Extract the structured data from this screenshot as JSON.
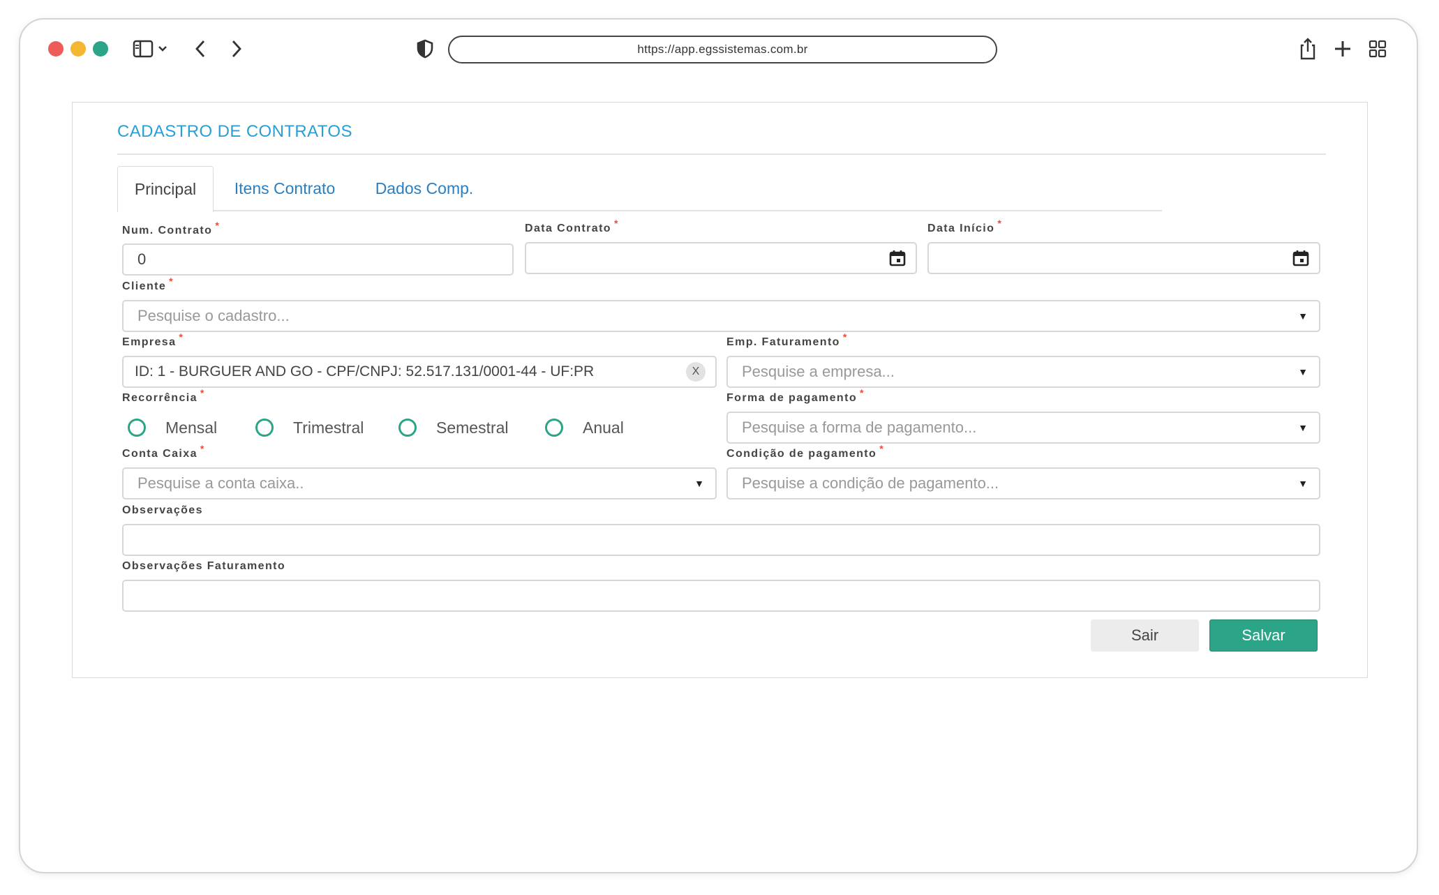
{
  "browser": {
    "url": "https://app.egssistemas.com.br",
    "colors": {
      "close": "#ed5c57",
      "minimize": "#f4b731",
      "zoom": "#2ca488"
    }
  },
  "page": {
    "title": "CADASTRO DE CONTRATOS",
    "tabs": [
      {
        "label": "Principal",
        "active": true
      },
      {
        "label": "Itens Contrato",
        "active": false
      },
      {
        "label": "Dados Comp.",
        "active": false
      }
    ]
  },
  "form": {
    "num_contrato": {
      "label": "Num. Contrato",
      "value": "0"
    },
    "data_contrato": {
      "label": "Data Contrato",
      "value": ""
    },
    "data_inicio": {
      "label": "Data Início",
      "value": ""
    },
    "cliente": {
      "label": "Cliente",
      "placeholder": "Pesquise o cadastro..."
    },
    "empresa": {
      "label": "Empresa",
      "value": "ID: 1 - BURGUER AND GO - CPF/CNPJ: 52.517.131/0001-44 - UF:PR",
      "clear": "X"
    },
    "emp_faturamento": {
      "label": "Emp. Faturamento",
      "placeholder": "Pesquise a empresa..."
    },
    "recorrencia": {
      "label": "Recorrência",
      "options": [
        "Mensal",
        "Trimestral",
        "Semestral",
        "Anual"
      ]
    },
    "forma_pagamento": {
      "label": "Forma de pagamento",
      "placeholder": "Pesquise a forma de pagamento..."
    },
    "conta_caixa": {
      "label": "Conta Caixa",
      "placeholder": "Pesquise a conta caixa.."
    },
    "condicao_pagamento": {
      "label": "Condição de pagamento",
      "placeholder": "Pesquise a condição de pagamento..."
    },
    "observacoes": {
      "label": "Observações",
      "value": ""
    },
    "observacoes_faturamento": {
      "label": "Observações Faturamento",
      "value": ""
    },
    "required_mark": "*"
  },
  "actions": {
    "exit_label": "Sair",
    "save_label": "Salvar"
  },
  "theme": {
    "accent": "#2ca488",
    "title_blue": "#2a9fd6",
    "tab_blue": "#2a7fc0",
    "required": "#e74c3c"
  }
}
